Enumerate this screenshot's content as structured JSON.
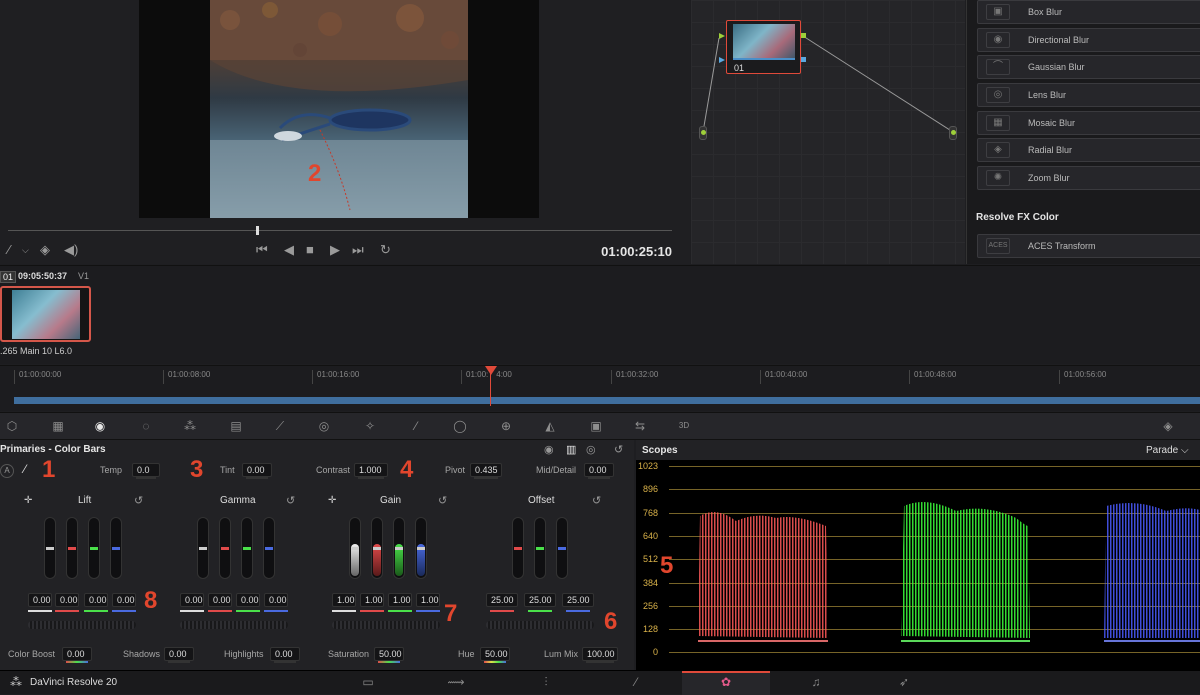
{
  "viewer": {
    "timecode": "01:00:25:10",
    "annotation": "2"
  },
  "node_graph": {
    "node_label": "01"
  },
  "library": {
    "items": [
      "Box Blur",
      "Directional Blur",
      "Gaussian Blur",
      "Lens Blur",
      "Mosaic Blur",
      "Radial Blur",
      "Zoom Blur"
    ],
    "section_title": "Resolve FX Color",
    "color_items": [
      "ACES Transform"
    ]
  },
  "clip": {
    "number": "01",
    "timecode": "09:05:50:37",
    "track": "V1",
    "codec": ".265 Main 10 L6.0"
  },
  "timeline": {
    "ticks": [
      "01:00:00:00",
      "01:00:08:00",
      "01:00:16:00",
      "01:00:",
      "01:00:32:00",
      "01:00:40:00",
      "01:00:48:00",
      "01:00:56:00"
    ],
    "tick_suffix": "4:00"
  },
  "primaries": {
    "title": "Primaries - Color Bars",
    "row": {
      "temp_label": "Temp",
      "temp_value": "0.0",
      "tint_label": "Tint",
      "tint_value": "0.00",
      "contrast_label": "Contrast",
      "contrast_value": "1.000",
      "pivot_label": "Pivot",
      "pivot_value": "0.435",
      "middetail_label": "Mid/Detail",
      "middetail_value": "0.00"
    },
    "wheels": [
      {
        "title": "Lift",
        "values": [
          "0.00",
          "0.00",
          "0.00",
          "0.00"
        ]
      },
      {
        "title": "Gamma",
        "values": [
          "0.00",
          "0.00",
          "0.00",
          "0.00"
        ]
      },
      {
        "title": "Gain",
        "values": [
          "1.00",
          "1.00",
          "1.00",
          "1.00"
        ]
      },
      {
        "title": "Offset",
        "values": [
          "25.00",
          "25.00",
          "25.00"
        ]
      }
    ],
    "bottom": {
      "colorboost_label": "Color Boost",
      "colorboost_value": "0.00",
      "shadows_label": "Shadows",
      "shadows_value": "0.00",
      "highlights_label": "Highlights",
      "highlights_value": "0.00",
      "saturation_label": "Saturation",
      "saturation_value": "50.00",
      "hue_label": "Hue",
      "hue_value": "50.00",
      "lummix_label": "Lum Mix",
      "lummix_value": "100.00"
    },
    "annotations": [
      "1",
      "3",
      "4",
      "8",
      "7",
      "6"
    ]
  },
  "scopes": {
    "title": "Scopes",
    "mode": "Parade",
    "y_labels": [
      "1023",
      "896",
      "768",
      "640",
      "512",
      "384",
      "256",
      "128",
      "0"
    ],
    "annotation": "5"
  },
  "status": {
    "app_name": "DaVinci Resolve 20"
  },
  "colors": {
    "accent_red": "#e04a3a",
    "annotation": "#e1462d",
    "scope_red": "#ff5a5a",
    "scope_green": "#3cff3c",
    "scope_blue": "#4a5bff"
  }
}
